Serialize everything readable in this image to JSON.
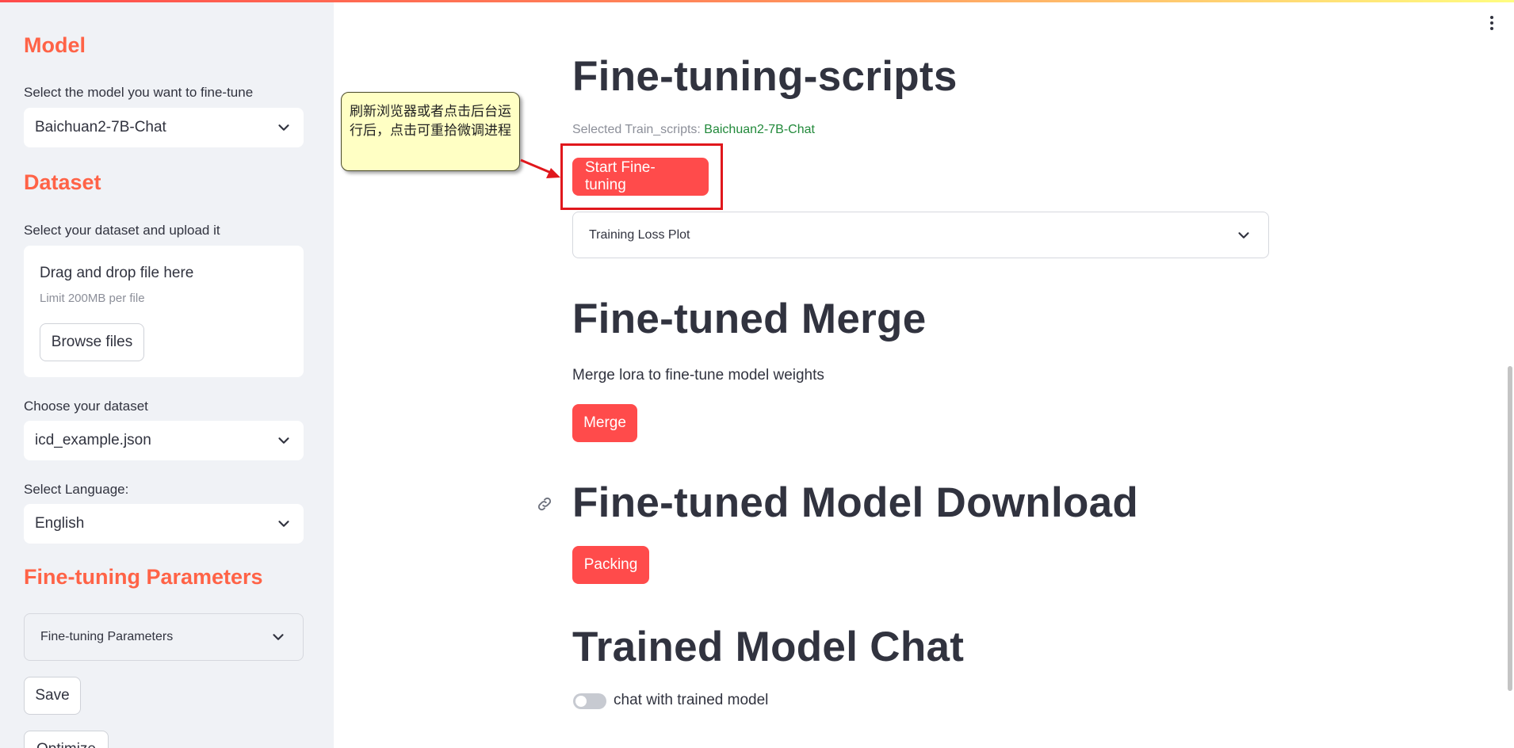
{
  "sidebar": {
    "model_heading": "Model",
    "model_label": "Select the model you want to fine-tune",
    "model_value": "Baichuan2-7B-Chat",
    "dataset_heading": "Dataset",
    "dataset_label": "Select your dataset and upload it",
    "uploader": {
      "title": "Drag and drop file here",
      "limit": "Limit 200MB per file",
      "browse": "Browse files"
    },
    "choose_dataset_label": "Choose your dataset",
    "dataset_value": "icd_example.json",
    "language_label": "Select Language:",
    "language_value": "English",
    "params_heading": "Fine-tuning Parameters",
    "params_expander": "Fine-tuning Parameters",
    "save_button": "Save",
    "optimize_button": "Optimize"
  },
  "main": {
    "scripts_title": "Fine-tuning-scripts",
    "selected_label": "Selected Train_scripts: ",
    "selected_value": "Baichuan2-7B-Chat",
    "start_button": "Start Fine-tuning",
    "annotation": "刷新浏览器或者点击后台运行后，点击可重拾微调进程",
    "loss_expander": "Training Loss Plot",
    "merge_title": "Fine-tuned Merge",
    "merge_desc": "Merge lora to fine-tune model weights",
    "merge_button": "Merge",
    "download_title": "Fine-tuned Model Download",
    "packing_button": "Packing",
    "chat_title": "Trained Model Chat",
    "chat_toggle_label": "chat with trained model",
    "chat_toggle_on": false
  },
  "colors": {
    "accent": "#ff4b4b",
    "sidebar_heading": "#ff6347",
    "sidebar_bg": "#f0f2f6",
    "highlight_box": "#e0171c",
    "caption_green": "#21893a"
  },
  "icons": [
    "chevron-down-icon",
    "link-icon",
    "kebab-menu-icon",
    "callout-arrow-icon"
  ]
}
